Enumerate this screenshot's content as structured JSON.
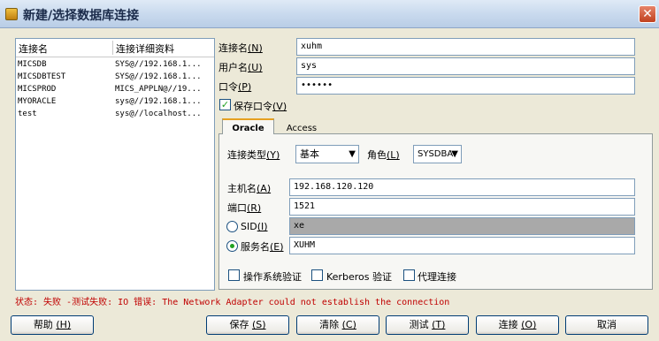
{
  "window": {
    "title": "新建/选择数据库连接",
    "close_glyph": "✕"
  },
  "conn_list": {
    "columns": [
      "连接名",
      "连接详细资料"
    ],
    "rows": [
      {
        "name": "MICSDB",
        "detail": "SYS@//192.168.1..."
      },
      {
        "name": "MICSDBTEST",
        "detail": "SYS@//192.168.1..."
      },
      {
        "name": "MICSPROD",
        "detail": "MICS_APPLN@//19..."
      },
      {
        "name": "MYORACLE",
        "detail": "sys@//192.168.1..."
      },
      {
        "name": "test",
        "detail": "sys@//localhost..."
      }
    ]
  },
  "form": {
    "conn_name_label": "连接名",
    "conn_name_key": "(N)",
    "conn_name_value": "xuhm",
    "user_label": "用户名",
    "user_key": "(U)",
    "user_value": "sys",
    "password_label": "口令",
    "password_key": "(P)",
    "password_value": "••••••",
    "save_password_label": "保存口令",
    "save_password_key": "(V)",
    "save_password_checked": true
  },
  "tabs": {
    "oracle": "Oracle",
    "access": "Access"
  },
  "oracle": {
    "conn_type_label": "连接类型",
    "conn_type_key": "(Y)",
    "conn_type_value": "基本",
    "role_label": "角色",
    "role_key": "(L)",
    "role_value": "SYSDBA",
    "host_label": "主机名",
    "host_key": "(A)",
    "host_value": "192.168.120.120",
    "port_label": "端口",
    "port_key": "(R)",
    "port_value": "1521",
    "sid_label": "SID",
    "sid_key": "(I)",
    "sid_value": "xe",
    "service_label": "服务名",
    "service_key": "(E)",
    "service_value": "XUHM",
    "os_auth_label": "操作系统验证",
    "kerberos_label": "Kerberos 验证",
    "proxy_label": "代理连接"
  },
  "status_text": "状态: 失败 -测试失败: IO 错误: The Network Adapter could not establish the connection",
  "buttons": {
    "help": "帮助",
    "help_key": "(H)",
    "save": "保存",
    "save_key": "(S)",
    "clear": "清除",
    "clear_key": "(C)",
    "test": "测试",
    "test_key": "(T)",
    "connect": "连接",
    "connect_key": "(O)",
    "cancel": "取消"
  },
  "colors": {
    "status_error": "#c00000",
    "checkbox_check": "#21a121"
  }
}
